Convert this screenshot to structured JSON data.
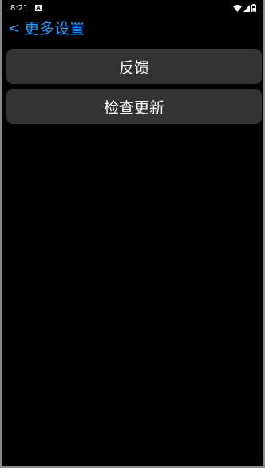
{
  "status_bar": {
    "time": "8:21",
    "notification_badge": "A",
    "icons": [
      "wifi-icon",
      "signal-icon",
      "battery-icon"
    ]
  },
  "header": {
    "back_arrow": "<",
    "title": "更多设置"
  },
  "menu": {
    "items": [
      {
        "label": "反馈"
      },
      {
        "label": "检查更新"
      }
    ]
  },
  "colors": {
    "background": "#000000",
    "accent": "#1e9bff",
    "button_bg": "#333333",
    "text": "#ffffff"
  }
}
